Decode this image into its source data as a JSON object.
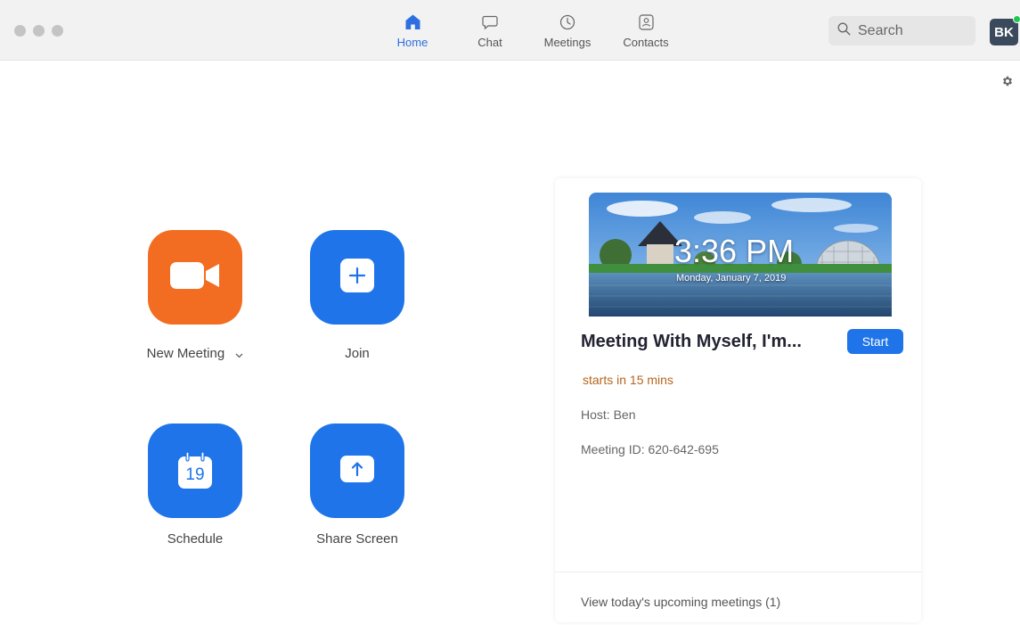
{
  "nav": {
    "items": [
      {
        "label": "Home",
        "icon": "home-icon",
        "active": true
      },
      {
        "label": "Chat",
        "icon": "chat-icon",
        "active": false
      },
      {
        "label": "Meetings",
        "icon": "clock-icon",
        "active": false
      },
      {
        "label": "Contacts",
        "icon": "contacts-icon",
        "active": false
      }
    ]
  },
  "search": {
    "placeholder": "Search"
  },
  "user": {
    "initials": "BK",
    "status_color": "#23c552"
  },
  "actions": {
    "new_meeting": {
      "label": "New Meeting",
      "icon": "video-camera-icon"
    },
    "join": {
      "label": "Join",
      "icon": "plus-icon"
    },
    "schedule": {
      "label": "Schedule",
      "icon": "calendar-icon",
      "day": "19"
    },
    "share_screen": {
      "label": "Share Screen",
      "icon": "upload-arrow-icon"
    }
  },
  "meeting_card": {
    "time": "3:36 PM",
    "date": "Monday, January 7, 2019",
    "title": "Meeting With Myself, I'm...",
    "start_label": "Start",
    "starts_in": "starts in 15 mins",
    "host": "Host: Ben",
    "meeting_id": "Meeting ID: 620-642-695",
    "upcoming_link": "View today's upcoming meetings (1)"
  },
  "colors": {
    "accent": "#1e74e8",
    "new_meeting": "#f26d21",
    "starts_in": "#b5651d"
  }
}
